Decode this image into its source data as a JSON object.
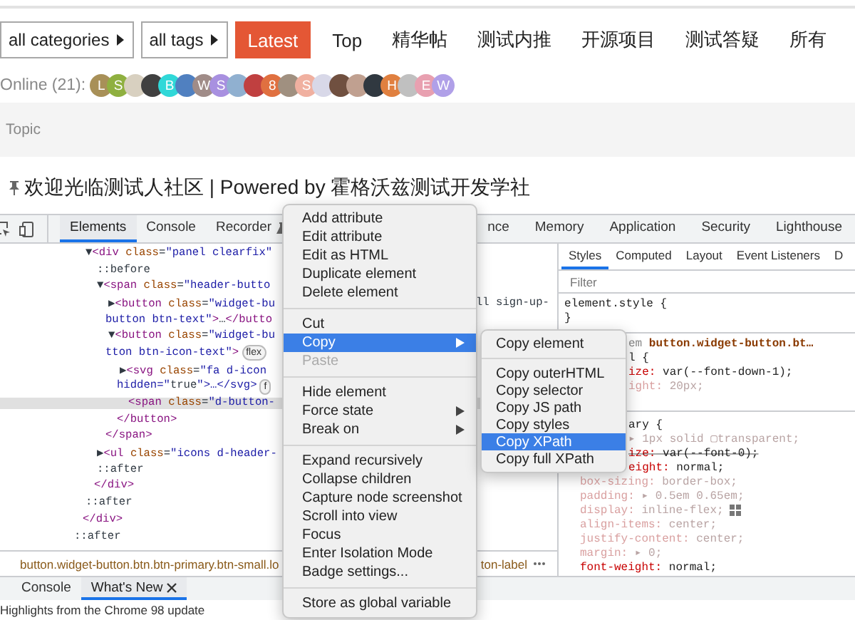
{
  "nav": {
    "filters": [
      {
        "label": "all categories"
      },
      {
        "label": "all tags"
      }
    ],
    "tabs": [
      {
        "label": "Latest",
        "selected": true
      },
      {
        "label": "Top",
        "selected": false
      },
      {
        "label": "精华帖",
        "selected": false
      },
      {
        "label": "测试内推",
        "selected": false
      },
      {
        "label": "开源项目",
        "selected": false
      },
      {
        "label": "测试答疑",
        "selected": false
      },
      {
        "label": "所有",
        "selected": false
      }
    ]
  },
  "online": {
    "label": "Online (21):",
    "avatars": [
      {
        "kind": "letter",
        "letter": "L",
        "color": "#a89058"
      },
      {
        "kind": "letter",
        "letter": "S",
        "color": "#8fb040"
      },
      {
        "kind": "photo",
        "color": "#d8d0c0"
      },
      {
        "kind": "photo",
        "color": "#404040"
      },
      {
        "kind": "letter",
        "letter": "B",
        "color": "#30d8d8"
      },
      {
        "kind": "photo",
        "color": "#5080c0"
      },
      {
        "kind": "letter",
        "letter": "W",
        "color": "#a08c88"
      },
      {
        "kind": "letter",
        "letter": "S",
        "color": "#a890e0"
      },
      {
        "kind": "photo",
        "color": "#90b0d0"
      },
      {
        "kind": "photo",
        "color": "#c04040"
      },
      {
        "kind": "letter",
        "letter": "8",
        "color": "#e07040"
      },
      {
        "kind": "photo",
        "color": "#a09080"
      },
      {
        "kind": "letter",
        "letter": "S",
        "color": "#f0b0a0"
      },
      {
        "kind": "photo",
        "color": "#d8d8e8"
      },
      {
        "kind": "photo",
        "color": "#705040"
      },
      {
        "kind": "photo",
        "color": "#c0a090"
      },
      {
        "kind": "photo",
        "color": "#303840"
      },
      {
        "kind": "letter",
        "letter": "H",
        "color": "#e08040"
      },
      {
        "kind": "photo",
        "color": "#c0c0c0"
      },
      {
        "kind": "letter",
        "letter": "E",
        "color": "#e8a0b0"
      },
      {
        "kind": "letter",
        "letter": "W",
        "color": "#b0a0e8"
      }
    ]
  },
  "topic_bar": {
    "label": "Topic"
  },
  "announcement": {
    "title": "欢迎光临测试人社区 | Powered by 霍格沃兹测试开发学社"
  },
  "devtools": {
    "tabs": [
      {
        "label": "Elements",
        "selected": true,
        "experimental": false
      },
      {
        "label": "Console",
        "selected": false,
        "experimental": false
      },
      {
        "label": "Recorder",
        "selected": false,
        "experimental": true
      }
    ],
    "more_tabs": [
      {
        "label": "nce",
        "selected": false
      },
      {
        "label": "Memory",
        "selected": false
      },
      {
        "label": "Application",
        "selected": false
      },
      {
        "label": "Security",
        "selected": false
      },
      {
        "label": "Lighthouse",
        "selected": false
      }
    ],
    "elements": {
      "nodes": [
        {
          "children": [
            {
              "text": "▼<div class=\"panel clearfix\"",
              "children": [
                {
                  "text": "::before"
                },
                {
                  "text": "▼<span class=\"header-butto",
                  "children": [
                    {
                      "text": "▶<button class=\"widget-bu",
                      "tail": "ll sign-up-",
                      "cont": "button btn-text\">…</butto"
                    },
                    {
                      "text": "▼<button class=\"widget-bu",
                      "cont": "tton btn-icon-text\">",
                      "badge": "flex",
                      "children": [
                        {
                          "text": "▶<svg class=\"fa d-icon",
                          "cont": "hidden=\"true\">…</svg>",
                          "badge": "f"
                        },
                        {
                          "text": "<span class=\"d-button-",
                          "selected": true
                        }
                      ],
                      "close": "</button>"
                    }
                  ],
                  "close": "</span>"
                },
                {
                  "text": "▶<ul class=\"icons d-header-"
                },
                {
                  "text": "::after"
                }
              ],
              "close": "</div>"
            },
            {
              "text": "::after"
            }
          ],
          "close": "</div>"
        },
        {
          "text": "::after"
        }
      ]
    },
    "breadcrumb": {
      "path": "button.widget-button.btn.btn-primary.btn-small.lo",
      "tail": "ton-label"
    },
    "styles": {
      "tabs": [
        {
          "label": "Styles",
          "selected": true
        },
        {
          "label": "Computed",
          "selected": false
        },
        {
          "label": "Layout",
          "selected": false
        },
        {
          "label": "Event Listeners",
          "selected": false
        },
        {
          "label": "D",
          "selected": false
        }
      ],
      "filter": {
        "placeholder": "Filter"
      },
      "rules": [
        {
          "lines": [
            {
              "kind": "selector",
              "text": "element.style {"
            },
            {
              "kind": "close",
              "text": "}"
            }
          ]
        },
        {
          "partial_lines": [
            {
              "kind": "header",
              "source": "em",
              "text": "button.widget-button.bt…"
            },
            {
              "kind": "selector",
              "text": "l {"
            },
            {
              "kind": "decl",
              "prop": "ize:",
              "value": "var(--font-down-1);",
              "inactive": false,
              "strike": false
            },
            {
              "kind": "decl",
              "prop": "ight:",
              "value": "20px;",
              "inactive": true,
              "strike": false
            }
          ]
        },
        {
          "partial_lines": [
            {
              "kind": "selector",
              "text": "ary {"
            },
            {
              "kind": "value",
              "value": "▸ 1px solid ▢transparent;",
              "inactive": true,
              "strike": false
            },
            {
              "kind": "decl",
              "prop": "ize:",
              "value": "var(--font-0);",
              "inactive": false,
              "strike": true
            },
            {
              "kind": "decl",
              "prop": "eight:",
              "value": "normal;",
              "inactive": false,
              "strike": false
            }
          ],
          "lines": [
            {
              "kind": "decl",
              "prop": "box-sizing:",
              "value": "border-box;",
              "inactive": true,
              "strike": false
            },
            {
              "kind": "decl",
              "prop": "padding:",
              "value": "▸ 0.5em 0.65em;",
              "inactive": true,
              "strike": false
            },
            {
              "kind": "decl",
              "prop": "display:",
              "value": "inline-flex;",
              "inactive": true,
              "strike": false,
              "editor": true
            },
            {
              "kind": "decl",
              "prop": "align-items:",
              "value": "center;",
              "inactive": true,
              "strike": false
            },
            {
              "kind": "decl",
              "prop": "justify-content:",
              "value": "center;",
              "inactive": true,
              "strike": false
            },
            {
              "kind": "decl",
              "prop": "margin:",
              "value": "▸ 0;",
              "inactive": true,
              "strike": false
            },
            {
              "kind": "decl",
              "prop": "font-weight:",
              "value": "normal;",
              "inactive": false,
              "strike": false
            }
          ]
        }
      ]
    },
    "drawer": {
      "tabs": [
        {
          "label": "Console",
          "selected": false,
          "closable": false
        },
        {
          "label": "What's New",
          "selected": true,
          "closable": true
        }
      ],
      "text": "Highlights from the Chrome 98 update"
    }
  },
  "context_menu": {
    "groups": [
      [
        {
          "label": "Add attribute",
          "selected": false,
          "disabled": false,
          "submenu": false
        },
        {
          "label": "Edit attribute",
          "selected": false,
          "disabled": false,
          "submenu": false
        },
        {
          "label": "Edit as HTML",
          "selected": false,
          "disabled": false,
          "submenu": false
        },
        {
          "label": "Duplicate element",
          "selected": false,
          "disabled": false,
          "submenu": false
        },
        {
          "label": "Delete element",
          "selected": false,
          "disabled": false,
          "submenu": false
        }
      ],
      [
        {
          "label": "Cut",
          "selected": false,
          "disabled": false,
          "submenu": false
        },
        {
          "label": "Copy",
          "selected": true,
          "disabled": false,
          "submenu": true
        },
        {
          "label": "Paste",
          "selected": false,
          "disabled": true,
          "submenu": false
        }
      ],
      [
        {
          "label": "Hide element",
          "selected": false,
          "disabled": false,
          "submenu": false
        },
        {
          "label": "Force state",
          "selected": false,
          "disabled": false,
          "submenu": true
        },
        {
          "label": "Break on",
          "selected": false,
          "disabled": false,
          "submenu": true
        }
      ],
      [
        {
          "label": "Expand recursively",
          "selected": false,
          "disabled": false,
          "submenu": false
        },
        {
          "label": "Collapse children",
          "selected": false,
          "disabled": false,
          "submenu": false
        },
        {
          "label": "Capture node screenshot",
          "selected": false,
          "disabled": false,
          "submenu": false
        },
        {
          "label": "Scroll into view",
          "selected": false,
          "disabled": false,
          "submenu": false
        },
        {
          "label": "Focus",
          "selected": false,
          "disabled": false,
          "submenu": false
        },
        {
          "label": "Enter Isolation Mode",
          "selected": false,
          "disabled": false,
          "submenu": false
        },
        {
          "label": "Badge settings...",
          "selected": false,
          "disabled": false,
          "submenu": false
        }
      ],
      [
        {
          "label": "Store as global variable",
          "selected": false,
          "disabled": false,
          "submenu": false
        }
      ]
    ]
  },
  "copy_submenu": {
    "groups": [
      [
        {
          "label": "Copy element",
          "selected": false,
          "disabled": false,
          "submenu": false
        }
      ],
      [
        {
          "label": "Copy outerHTML",
          "selected": false,
          "disabled": false,
          "submenu": false
        },
        {
          "label": "Copy selector",
          "selected": false,
          "disabled": false,
          "submenu": false
        },
        {
          "label": "Copy JS path",
          "selected": false,
          "disabled": false,
          "submenu": false
        },
        {
          "label": "Copy styles",
          "selected": false,
          "disabled": false,
          "submenu": false
        },
        {
          "label": "Copy XPath",
          "selected": true,
          "disabled": false,
          "submenu": false
        },
        {
          "label": "Copy full XPath",
          "selected": false,
          "disabled": false,
          "submenu": false
        }
      ]
    ]
  }
}
